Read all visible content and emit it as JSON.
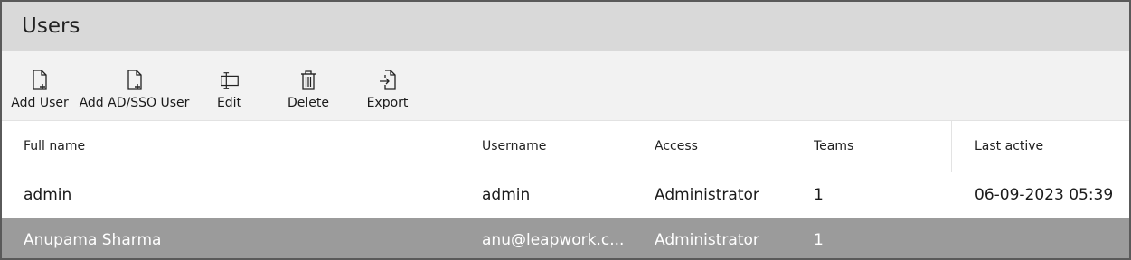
{
  "title": "Users",
  "toolbar": {
    "add_user": {
      "label": "Add User",
      "icon": "add-document-icon"
    },
    "add_ad_sso_user": {
      "label": "Add AD/SSO User",
      "icon": "add-document-icon"
    },
    "edit": {
      "label": "Edit",
      "icon": "edit-text-icon"
    },
    "delete": {
      "label": "Delete",
      "icon": "trash-icon"
    },
    "export": {
      "label": "Export",
      "icon": "export-icon"
    }
  },
  "table": {
    "columns": {
      "full_name": "Full name",
      "username": "Username",
      "access": "Access",
      "teams": "Teams",
      "last_active": "Last active"
    },
    "rows": [
      {
        "full_name": "admin",
        "username": "admin",
        "access": "Administrator",
        "teams": "1",
        "last_active": "06-09-2023 05:39"
      },
      {
        "full_name": "Anupama Sharma",
        "username": "anu@leapwork.c...",
        "access": "Administrator",
        "teams": "1",
        "last_active": "",
        "selected": true
      }
    ]
  },
  "colors": {
    "title_bar": "#d9d9d9",
    "toolbar": "#f2f2f2",
    "selected_row": "#9b9b9b",
    "border": "#5a5a5a"
  }
}
